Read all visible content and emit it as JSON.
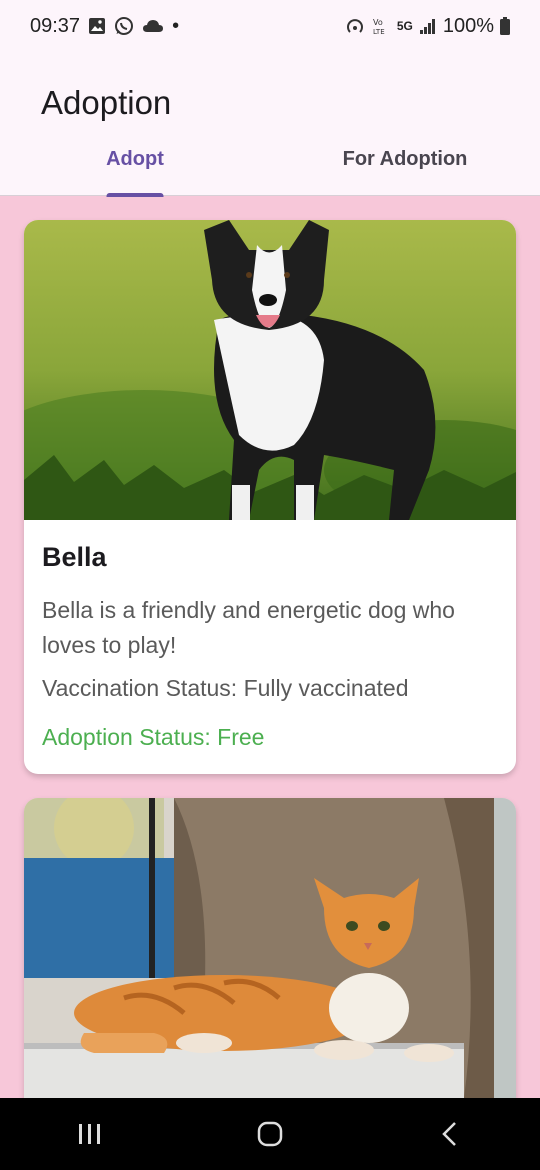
{
  "status_bar": {
    "time": "09:37",
    "dot": "•",
    "network": "5G",
    "battery": "100%",
    "icons": [
      "gallery-icon",
      "whatsapp-icon",
      "cloud-icon",
      "hotspot-icon",
      "volte-icon",
      "signal-icon",
      "battery-icon"
    ]
  },
  "header": {
    "title": "Adoption"
  },
  "tabs": [
    {
      "label": "Adopt",
      "active": true
    },
    {
      "label": "For Adoption",
      "active": false
    }
  ],
  "pets": [
    {
      "name": "Bella",
      "description": "Bella is a friendly and energetic dog who loves to play!",
      "vaccination": "Vaccination Status: Fully vaccinated",
      "adoption": "Adoption Status: Free",
      "photo": "dog-photo"
    },
    {
      "photo": "cat-photo"
    }
  ],
  "colors": {
    "background": "#f7c7d9",
    "accent": "#6750a4",
    "adoption_status": "#4caf50",
    "surface": "#fdf5fb"
  },
  "nav": {
    "icons": [
      "recent-apps-icon",
      "home-icon",
      "back-icon"
    ]
  }
}
